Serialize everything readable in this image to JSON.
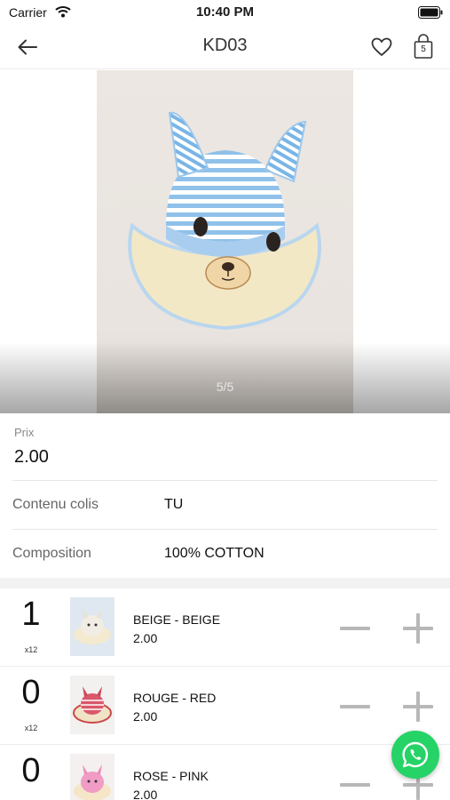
{
  "status": {
    "carrier": "Carrier",
    "time": "10:40 PM"
  },
  "nav": {
    "title": "KD03",
    "cart_count": "5"
  },
  "gallery": {
    "counter": "5/5",
    "current": 5,
    "total": 5
  },
  "price": {
    "label": "Prix",
    "value": "2.00"
  },
  "details": [
    {
      "key": "Contenu colis",
      "value": "TU"
    },
    {
      "key": "Composition",
      "value": "100% COTTON"
    }
  ],
  "variants": [
    {
      "qty": "1",
      "pack": "x12",
      "name": "BEIGE - BEIGE",
      "price": "2.00"
    },
    {
      "qty": "0",
      "pack": "x12",
      "name": "ROUGE - RED",
      "price": "2.00"
    },
    {
      "qty": "0",
      "pack": "",
      "name": "ROSE - PINK",
      "price": "2.00"
    }
  ],
  "colors": {
    "accent_whatsapp": "#25d366",
    "stepper_gray": "#b8b8b8"
  },
  "icons": [
    "back-arrow-icon",
    "heart-icon",
    "shopping-bag-icon",
    "minus-icon",
    "plus-icon",
    "whatsapp-icon",
    "wifi-icon",
    "battery-icon"
  ]
}
